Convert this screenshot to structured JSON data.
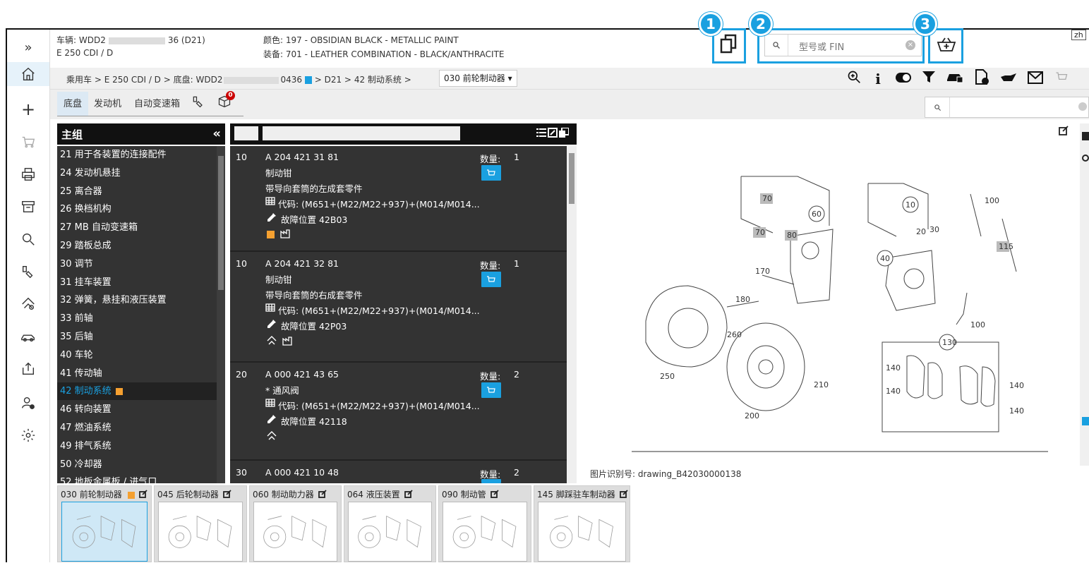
{
  "header": {
    "vehicle_label": "车辆: WDD2",
    "vehicle_suffix": "36 (D21)",
    "model": "E 250 CDI / D",
    "color": "颜色: 197 - OBSIDIAN BLACK - METALLIC PAINT",
    "equipment": "装备: 701 - LEATHER COMBINATION - BLACK/ANTHRACITE",
    "search_placeholder": "型号或 FIN",
    "lang": "zh",
    "callouts": [
      "1",
      "2",
      "3"
    ]
  },
  "breadcrumb": {
    "items": [
      "乘用车",
      "E 250 CDI / D",
      "底盘: WDD2",
      "0436",
      "D21",
      "42 制动系统"
    ],
    "separator": ">",
    "current": "030 前轮制动器"
  },
  "tabs": [
    "底盘",
    "发动机",
    "自动变速箱"
  ],
  "tabs_badge": "0",
  "main_group": {
    "title": "主组",
    "items": [
      "21 用于各装置的连接配件",
      "24 发动机悬挂",
      "25 离合器",
      "26 换档机构",
      "27 MB 自动变速箱",
      "29 踏板总成",
      "30 调节",
      "31 挂车装置",
      "32 弹簧，悬挂和液压装置",
      "33 前轴",
      "35 后轴",
      "40 车轮",
      "41 传动轴",
      "42 制动系统",
      "46 转向装置",
      "47 燃油系统",
      "49 排气系统",
      "50 冷却器",
      "52 地板金属板 / 进气口"
    ],
    "selected_index": 13
  },
  "parts": [
    {
      "pos": "10",
      "number": "A 204 421 31 81",
      "qty_label": "数量:",
      "qty": "1",
      "name": "制动钳",
      "desc": "带导向套筒的左成套零件",
      "code": "代码: (M651+(M22/M22+937)+(M014/M014...",
      "fault": "故障位置 42B03"
    },
    {
      "pos": "10",
      "number": "A 204 421 32 81",
      "qty_label": "数量:",
      "qty": "1",
      "name": "制动钳",
      "desc": "带导向套筒的右成套零件",
      "code": "代码: (M651+(M22/M22+937)+(M014/M014...",
      "fault": "故障位置 42P03"
    },
    {
      "pos": "20",
      "number": "A 000 421 43 65",
      "qty_label": "数量:",
      "qty": "2",
      "name": "* 通风阀",
      "desc": "",
      "code": "代码: (M651+(M22/M22+937)+(M014/M014...",
      "fault": "故障位置 42118"
    },
    {
      "pos": "30",
      "number": "A 000 421 10 48",
      "qty_label": "数量:",
      "qty": "2",
      "name": "",
      "desc": "",
      "code": "",
      "fault": ""
    }
  ],
  "drawing": {
    "caption": "图片识别号: drawing_B42030000138",
    "labels": [
      "70",
      "70",
      "80",
      "60",
      "10",
      "100",
      "20",
      "30",
      "115",
      "40",
      "170",
      "180",
      "100",
      "260",
      "130",
      "140",
      "140",
      "250",
      "210",
      "140",
      "140",
      "200"
    ]
  },
  "thumbnails": [
    "030 前轮制动器",
    "045 后轮制动器",
    "060 制动助力器",
    "064 液压装置",
    "090 制动管",
    "145 脚踩驻车制动器"
  ],
  "colors": {
    "accent": "#1aa0e0",
    "dark_panel": "#333333",
    "note_orange": "#f5a030"
  }
}
